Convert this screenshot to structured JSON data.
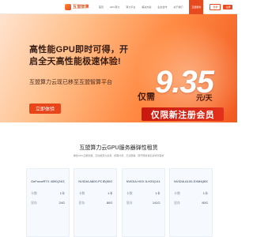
{
  "header": {
    "logo_text": "互盟智算",
    "nav": [
      "首页",
      "GPU算力",
      "算力平台",
      "解决方案",
      "生态合作",
      "关于我们",
      "互盟服务"
    ],
    "active_nav_index": 6,
    "login_label": "登录",
    "register_label": "注册"
  },
  "hero": {
    "title": "高性能GPU即时可得，开启全天高性能极速体验!",
    "subtitle": "互盟算力云现已移至互盟智算平台",
    "cta_label": "立即体验",
    "price_prefix": "仅需",
    "price": "9.35",
    "price_unit": "元/天",
    "promo": "仅限新注册会员"
  },
  "section": {
    "title": "互盟算力云GPU服务器弹性租赁",
    "subtitle": "弹性GPU云服务器，高性能算力资源，按需付费，灵活部署，即开即用满足多场景需求"
  },
  "spec_labels": {
    "cards": "卡数",
    "memory": "显存"
  },
  "cards": [
    {
      "title": "GeForceRTX 4090(24G)",
      "cards_value": "1卡",
      "memory_value": "24G"
    },
    {
      "title": "NVIDIA A800-PCIE(80G)",
      "cards_value": "1卡",
      "memory_value": "80G"
    },
    {
      "title": "NVIDIA HGX 8-H20(141G)",
      "cards_value": "1卡",
      "memory_value": "141G"
    },
    {
      "title": "NVIDIA A100-SXM4(80G)",
      "cards_value": "1卡",
      "memory_value": "80G"
    }
  ],
  "colors": {
    "accent": "#e84a1f",
    "promo": "#d0241a"
  }
}
